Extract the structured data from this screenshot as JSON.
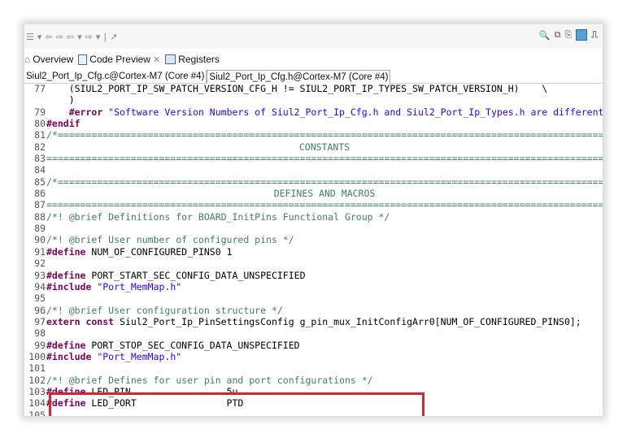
{
  "toolbar": {
    "left_icons": [
      "☰",
      "▾",
      "⇦",
      "⇨",
      "⇦",
      "▾",
      "⇨",
      "▾",
      "|",
      "↗"
    ],
    "right_icons": [
      "search-icon",
      "copy-icon",
      "pin-icon",
      "grid-icon",
      "chip-icon"
    ]
  },
  "view_tabs": [
    {
      "label": "Overview",
      "icon": "home-icon"
    },
    {
      "label": "Code Preview",
      "icon": "document-icon"
    },
    {
      "label": "Registers",
      "icon": "registers-icon"
    }
  ],
  "file_tabs": [
    {
      "label": "Siul2_Port_Ip_Cfg.c@Cortex-M7 (Core #4)",
      "active": false
    },
    {
      "label": "Siul2_Port_Ip_Cfg.h@Cortex-M7 (Core #4)",
      "active": true
    }
  ],
  "code_lines": [
    {
      "num": "77",
      "text": "    (SIUL2_PORT_IP_SW_PATCH_VERSION_CFG_H != SIUL2_PORT_IP_TYPES_SW_PATCH_VERSION_H)    \\"
    },
    {
      "num": "",
      "text": "    )"
    },
    {
      "num": "79",
      "pre": "    ",
      "kw": "#error",
      "str": " \"Software Version Numbers of Siul2_Port_Ip_Cfg.h and Siul2_Port_Ip_Types.h are different"
    },
    {
      "num": "80",
      "kw": "#endif"
    },
    {
      "num": "81",
      "comment": "/*=========================================================================================================="
    },
    {
      "num": "82",
      "center": "CONSTANTS"
    },
    {
      "num": "83",
      "comment": "==========================================================================================================*/"
    },
    {
      "num": "84",
      "text": ""
    },
    {
      "num": "85",
      "comment": "/*=========================================================================================================="
    },
    {
      "num": "86",
      "center": "DEFINES AND MACROS"
    },
    {
      "num": "87",
      "comment": "==========================================================================================================*/"
    },
    {
      "num": "88",
      "comment": "/*! @brief Definitions for BOARD_InitPins Functional Group */"
    },
    {
      "num": "89",
      "text": ""
    },
    {
      "num": "90",
      "comment": "/*! @brief User number of configured pins */"
    },
    {
      "num": "91",
      "kw": "#define",
      "text": " NUM_OF_CONFIGURED_PINS0 1"
    },
    {
      "num": "92",
      "text": ""
    },
    {
      "num": "93",
      "kw": "#define",
      "text": " PORT_START_SEC_CONFIG_DATA_UNSPECIFIED"
    },
    {
      "num": "94",
      "kw": "#include",
      "str": " \"Port_MemMap.h\""
    },
    {
      "num": "95",
      "text": ""
    },
    {
      "num": "96",
      "comment": "/*! @brief User configuration structure */"
    },
    {
      "num": "97",
      "kw": "extern const",
      "text": " Siul2_Port_Ip_PinSettingsConfig g_pin_mux_InitConfigArr0[NUM_OF_CONFIGURED_PINS0];"
    },
    {
      "num": "98",
      "text": ""
    },
    {
      "num": "99",
      "kw": "#define",
      "text": " PORT_STOP_SEC_CONFIG_DATA_UNSPECIFIED"
    },
    {
      "num": "100",
      "kw": "#include",
      "str": " \"Port_MemMap.h\""
    },
    {
      "num": "101",
      "text": ""
    },
    {
      "num": "102",
      "comment": "/*! @brief Defines for user pin and port configurations */"
    },
    {
      "num": "103",
      "kw": "#define",
      "text": " LED_PIN                 5u"
    },
    {
      "num": "104",
      "kw": "#define",
      "text": " LED_PORT                PTD"
    },
    {
      "num": "105",
      "text": ""
    }
  ],
  "colors": {
    "highlight_border": "#d9242f",
    "keyword": "#7f0055",
    "comment": "#3f7f5f",
    "string": "#2a00ff"
  }
}
